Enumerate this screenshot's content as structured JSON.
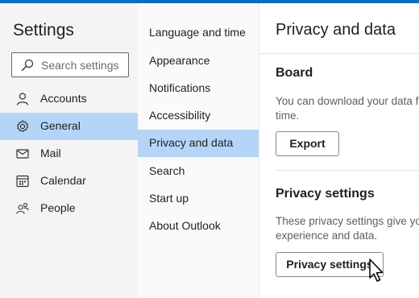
{
  "left": {
    "title": "Settings",
    "search_placeholder": "Search settings",
    "items": [
      {
        "label": "Accounts",
        "icon": "person-icon"
      },
      {
        "label": "General",
        "icon": "gear-icon"
      },
      {
        "label": "Mail",
        "icon": "envelope-icon"
      },
      {
        "label": "Calendar",
        "icon": "calendar-icon"
      },
      {
        "label": "People",
        "icon": "people-icon"
      }
    ],
    "selected": "General"
  },
  "middle": {
    "items": [
      {
        "label": "Language and time"
      },
      {
        "label": "Appearance"
      },
      {
        "label": "Notifications"
      },
      {
        "label": "Accessibility"
      },
      {
        "label": "Privacy and data"
      },
      {
        "label": "Search"
      },
      {
        "label": "Start up"
      },
      {
        "label": "About Outlook"
      }
    ],
    "selected": "Privacy and data"
  },
  "main": {
    "title": "Privacy and data",
    "board": {
      "title": "Board",
      "desc_line1": "You can download your data fr",
      "desc_line2": "time.",
      "button": "Export"
    },
    "privacy": {
      "title": "Privacy settings",
      "desc_line1": "These privacy settings give you",
      "desc_line2": "experience and data.",
      "button": "Privacy settings"
    }
  },
  "colors": {
    "accent": "#0f6cbd",
    "selected_bg": "#b4d5f8",
    "left_bg": "#f4f4f4",
    "mid_bg": "#fafafa"
  }
}
